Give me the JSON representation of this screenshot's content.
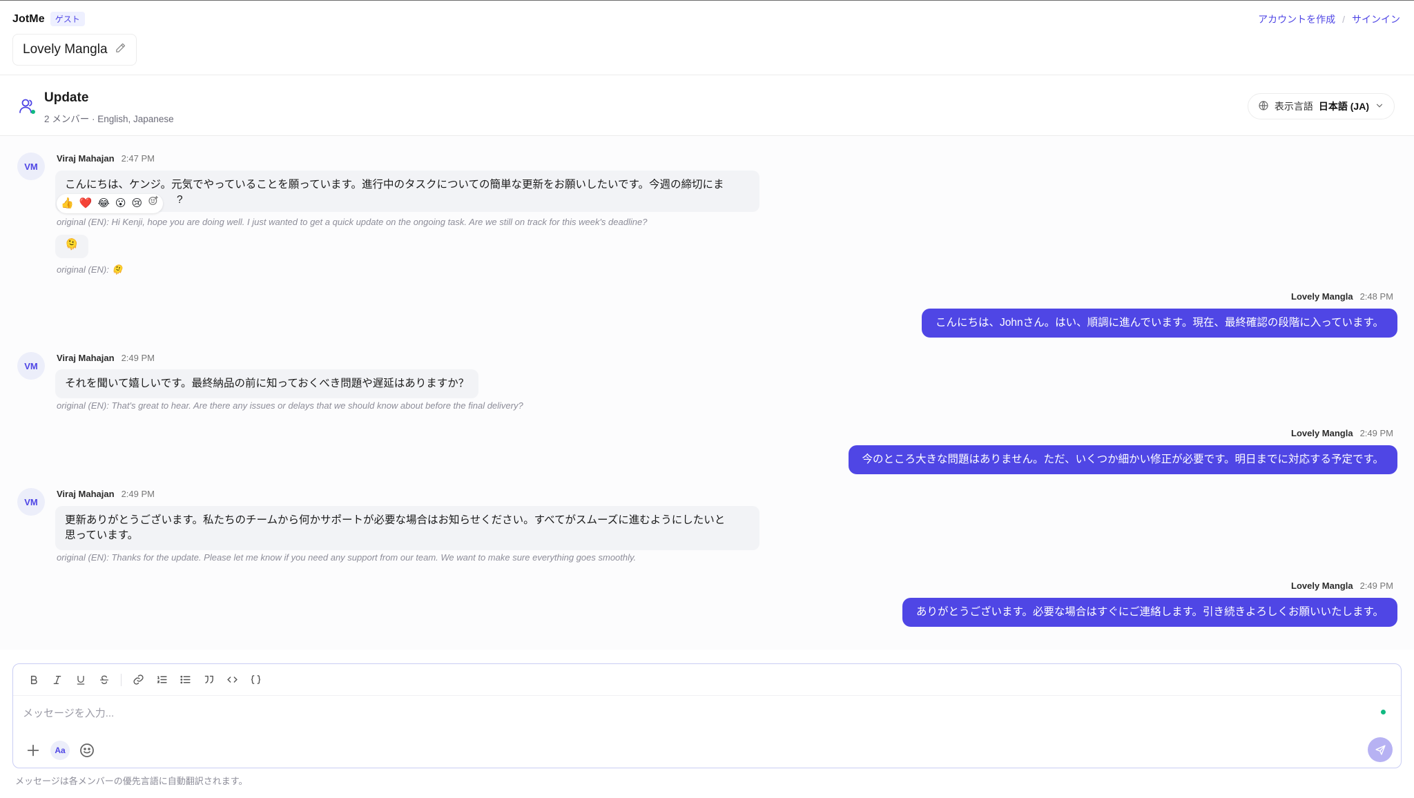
{
  "app": {
    "brand": "JotMe",
    "guest_badge": "ゲスト",
    "create_account": "アカウントを作成",
    "separator": "/",
    "sign_in": "サインイン",
    "title": "Lovely Mangla"
  },
  "channel": {
    "title": "Update",
    "subtitle": "2 メンバー · English, Japanese",
    "lang_label": "表示言語",
    "lang_value": "日本語 (JA)"
  },
  "reactions": [
    "👍",
    "❤️",
    "😂",
    "😮",
    "😢"
  ],
  "messages": [
    {
      "initials": "VM",
      "name": "Viraj Mahajan",
      "time": "2:47 PM",
      "text": "こんにちは、ケンジ。元気でやっていることを願っています。進行中のタスクについての簡単な更新をお願いしたいです。今週の締切にま",
      "text_overflow": "?",
      "original": "original (EN): Hi Kenji, hope you are doing well. I just wanted to get a quick update on the ongoing task. Are we still on track for this week's deadline?"
    },
    {
      "text": "🫠",
      "original": "original (EN): 🫠"
    },
    {
      "name": "Lovely Mangla",
      "time": "2:48 PM",
      "text": "こんにちは、Johnさん。はい、順調に進んでいます。現在、最終確認の段階に入っています。"
    },
    {
      "initials": "VM",
      "name": "Viraj Mahajan",
      "time": "2:49 PM",
      "text": "それを聞いて嬉しいです。最終納品の前に知っておくべき問題や遅延はありますか？",
      "original": "original (EN): That's great to hear. Are there any issues or delays that we should know about before the final delivery?"
    },
    {
      "name": "Lovely Mangla",
      "time": "2:49 PM",
      "text": "今のところ大きな問題はありません。ただ、いくつか細かい修正が必要です。明日までに対応する予定です。"
    },
    {
      "initials": "VM",
      "name": "Viraj Mahajan",
      "time": "2:49 PM",
      "text_line1": "更新ありがとうございます。私たちのチームから何かサポートが必要な場合はお知らせください。すべてがスムーズに進むようにしたいと",
      "text_line2": "思っています。",
      "original": "original (EN): Thanks for the update. Please let me know if you need any support from our team. We want to make sure everything goes smoothly."
    },
    {
      "name": "Lovely Mangla",
      "time": "2:49 PM",
      "text": "ありがとうございます。必要な場合はすぐにご連絡します。引き続きよろしくお願いいたします。"
    }
  ],
  "composer": {
    "placeholder": "メッセージを入力...",
    "aa_label": "Aa",
    "footnote": "メッセージは各メンバーの優先言語に自動翻訳されます。"
  },
  "colors": {
    "accent": "#4f46e5",
    "online": "#10b981"
  }
}
